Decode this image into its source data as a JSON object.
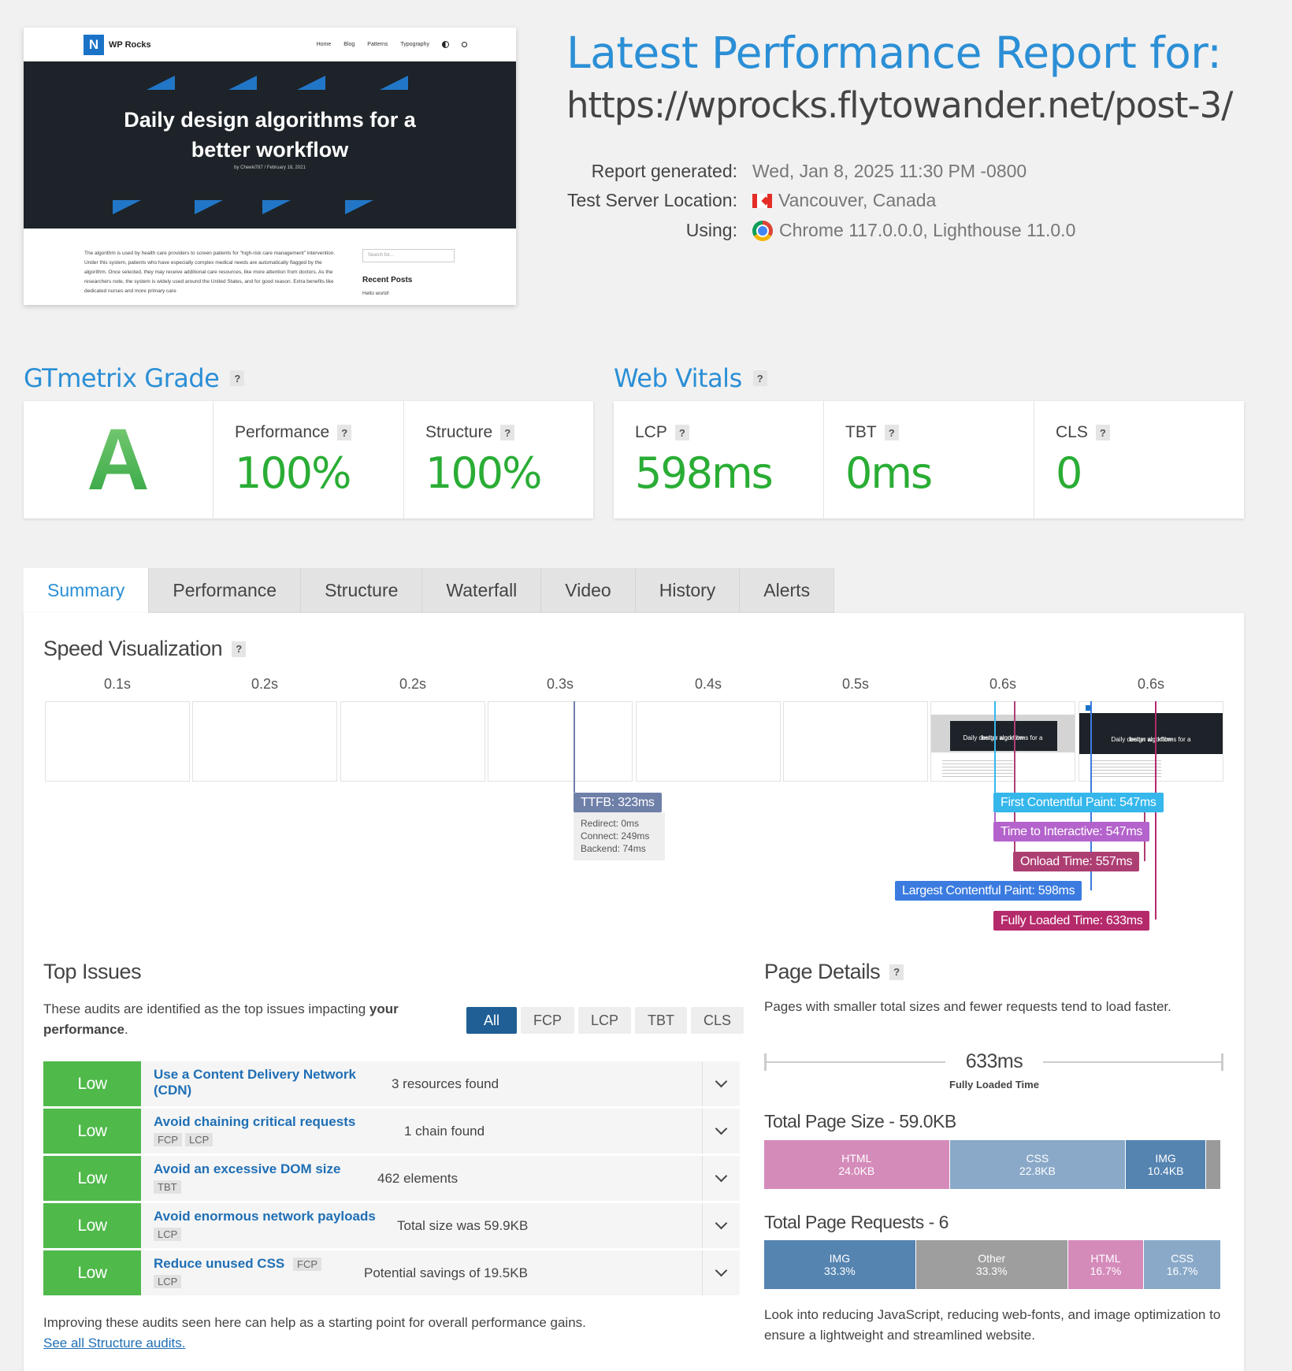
{
  "preview": {
    "site_name": "WP Rocks",
    "logo_letter": "N",
    "nav": [
      "Home",
      "Blog",
      "Patterns",
      "Typography"
    ],
    "headline_line1": "Daily design algorithms for a",
    "headline_line2": "better workflow",
    "byline": "by Cheeki787 / February 18, 2021",
    "body_text": "The algorithm is used by health care providers to screen patients for \"high-risk care management\" intervention. Under this system, patients who have especially complex medical needs are automatically flagged by the algorithm. Once selected, they may receive additional care resources, like more attention from doctors. As the researchers note, the system is widely used around the United States, and for good reason. Extra benefits like dedicated nurses and more primary care",
    "search_placeholder": "Search for...",
    "sidebar_heading": "Recent Posts",
    "sidebar_link": "Hello world!"
  },
  "report": {
    "title": "Latest Performance Report for:",
    "url": "https://wprocks.flytowander.net/post-3/",
    "generated_label": "Report generated:",
    "generated_value": "Wed, Jan 8, 2025 11:30 PM -0800",
    "location_label": "Test Server Location:",
    "location_value": "Vancouver, Canada",
    "using_label": "Using:",
    "using_value": "Chrome 117.0.0.0, Lighthouse 11.0.0"
  },
  "grade": {
    "title": "GTmetrix Grade",
    "letter": "A",
    "performance_label": "Performance",
    "performance_value": "100%",
    "structure_label": "Structure",
    "structure_value": "100%"
  },
  "vitals": {
    "title": "Web Vitals",
    "lcp_label": "LCP",
    "lcp_value": "598ms",
    "tbt_label": "TBT",
    "tbt_value": "0ms",
    "cls_label": "CLS",
    "cls_value": "0"
  },
  "tabs": [
    "Summary",
    "Performance",
    "Structure",
    "Waterfall",
    "Video",
    "History",
    "Alerts"
  ],
  "speed": {
    "title": "Speed Visualization",
    "ticks": [
      "0.1s",
      "0.2s",
      "0.2s",
      "0.3s",
      "0.4s",
      "0.5s",
      "0.6s",
      "0.6s"
    ],
    "frame_caption_1": "Daily design algorithms for a",
    "frame_caption_2": "better workflow",
    "ttfb": "TTFB: 323ms",
    "redirect": "Redirect: 0ms",
    "connect": "Connect: 249ms",
    "backend": "Backend: 74ms",
    "fcp": "First Contentful Paint: 547ms",
    "tti": "Time to Interactive: 547ms",
    "onload": "Onload Time: 557ms",
    "lcp": "Largest Contentful Paint: 598ms",
    "fully": "Fully Loaded Time: 633ms"
  },
  "issues": {
    "title": "Top Issues",
    "intro_plain": "These audits are identified as the top issues impacting ",
    "intro_bold1": "your",
    "intro_bold2": "performance",
    "intro_end": ".",
    "filters": [
      "All",
      "FCP",
      "LCP",
      "TBT",
      "CLS"
    ],
    "items": [
      {
        "level": "Low",
        "name1": "Use a Content Delivery Network",
        "name2": "(CDN)",
        "value": "3 resources found"
      },
      {
        "level": "Low",
        "name1": "Avoid chaining critical requests",
        "tags": [
          "FCP",
          "LCP"
        ],
        "value": "1 chain found"
      },
      {
        "level": "Low",
        "name1": "Avoid an excessive DOM size",
        "tags": [
          "TBT"
        ],
        "value": "462 elements"
      },
      {
        "level": "Low",
        "name1": "Avoid enormous network payloads",
        "tags": [
          "LCP"
        ],
        "value": "Total size was 59.9KB"
      },
      {
        "level": "Low",
        "name1": "Reduce unused CSS",
        "tags": [
          "FCP",
          "LCP"
        ],
        "value": "Potential savings of 19.5KB"
      }
    ],
    "footer": "Improving these audits seen here can help as a starting point for overall performance gains.",
    "link": "See all Structure audits."
  },
  "details": {
    "title": "Page Details",
    "intro": "Pages with smaller total sizes and fewer requests tend to load faster.",
    "fully_value": "633ms",
    "fully_label": "Fully Loaded Time",
    "size_title": "Total Page Size - 59.0KB",
    "size_segments": [
      {
        "label": "HTML",
        "value": "24.0KB",
        "fraction": 0.407,
        "color": "#d48bba"
      },
      {
        "label": "CSS",
        "value": "22.8KB",
        "fraction": 0.386,
        "color": "#8aa9c9"
      },
      {
        "label": "IMG",
        "value": "10.4KB",
        "fraction": 0.176,
        "color": "#5584b1"
      },
      {
        "label": "",
        "value": "",
        "fraction": 0.031,
        "color": "#9a9a9a"
      }
    ],
    "req_title": "Total Page Requests - 6",
    "req_segments": [
      {
        "label": "IMG",
        "value": "33.3%",
        "fraction": 0.333,
        "color": "#5584b1"
      },
      {
        "label": "Other",
        "value": "33.3%",
        "fraction": 0.333,
        "color": "#9e9e9e"
      },
      {
        "label": "HTML",
        "value": "16.7%",
        "fraction": 0.167,
        "color": "#d48bba"
      },
      {
        "label": "CSS",
        "value": "16.7%",
        "fraction": 0.167,
        "color": "#8aa9c9"
      }
    ],
    "footer": "Look into reducing JavaScript, reducing web-fonts, and image optimization to ensure a lightweight and streamlined website."
  },
  "colors": {
    "accent": "#2b8fd6",
    "good": "#2aad35",
    "low_badge": "#4fb94a",
    "ttfb": "#6e7fa8",
    "fcp": "#35b7ec",
    "tti": "#b463cc",
    "onload": "#ad3e72",
    "lcp": "#3b7be0",
    "fully": "#b52a6b"
  }
}
